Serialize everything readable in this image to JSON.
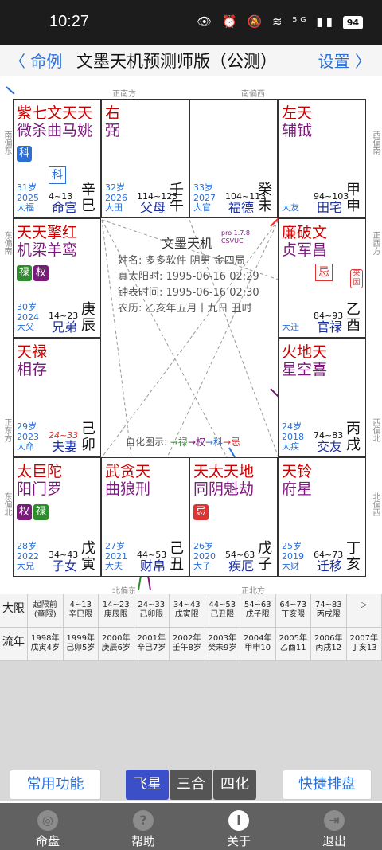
{
  "status": {
    "time": "10:27",
    "battery": "94",
    "icons": "👁 ⏰ 🔕 ≋ ⁵ᴳ ▮▮"
  },
  "nav": {
    "back": "〈 命例",
    "title": "文墨天机预测师版（公测）",
    "settings": "设置 〉"
  },
  "directions": {
    "top1": "正南方",
    "top2": "南偏西",
    "bottom1": "北偏东",
    "bottom2": "正北方",
    "left1": "南偏东",
    "left2": "东偏南",
    "left3": "正东方",
    "left4": "东偏北",
    "right1": "西偏南",
    "right2": "正西方",
    "right3": "西偏北",
    "right4": "北偏西"
  },
  "palaces": [
    {
      "stars_r": "紫七文天天",
      "stars_p": "微杀曲马姚",
      "badges": [
        {
          "t": "科",
          "c": "#2b6fd6"
        }
      ],
      "mark": "科",
      "age": "31岁",
      "year": "2025",
      "yname": "大福",
      "range": "4~13",
      "name": "命宫",
      "gz": "辛巳"
    },
    {
      "stars_r": "右",
      "stars_p": "弼",
      "badges": [],
      "mark": "",
      "age": "32岁",
      "year": "2026",
      "yname": "大田",
      "range": "114~123",
      "name": "父母",
      "gz": "壬午"
    },
    {
      "stars_r": "",
      "stars_p": "",
      "badges": [],
      "mark": "",
      "age": "33岁",
      "year": "2027",
      "yname": "大官",
      "range": "104~113",
      "name": "福德",
      "gz": "癸未"
    },
    {
      "stars_r": "左天",
      "stars_p": "辅钺",
      "badges": [],
      "mark": "",
      "age": "",
      "year": "",
      "yname": "大友",
      "range": "94~103",
      "name": "田宅",
      "gz": "甲申"
    },
    {
      "stars_r": "天天擎红",
      "stars_p": "机梁羊鸾",
      "badges": [
        {
          "t": "禄",
          "c": "#2e8b2e"
        },
        {
          "t": "权",
          "c": "#7a1a7a"
        }
      ],
      "mark": "",
      "age": "30岁",
      "year": "2024",
      "yname": "大父",
      "range": "14~23",
      "name": "兄弟",
      "gz": "庚辰"
    },
    {
      "stars_r": "廉破文",
      "stars_p": "贞军昌",
      "badges": [],
      "mark": "忌",
      "age": "",
      "year": "",
      "yname": "大迁",
      "range": "84~93",
      "name": "官禄",
      "gz": "乙酉"
    },
    {
      "stars_r": "天禄",
      "stars_p": "相存",
      "badges": [],
      "mark": "",
      "age": "29岁",
      "year": "2023",
      "yname": "大命",
      "range": "24~33",
      "name": "夫妻",
      "gz": "己卯"
    },
    {
      "stars_r": "火地天",
      "stars_p": "星空喜",
      "badges": [],
      "mark": "",
      "age": "24岁",
      "year": "2018",
      "yname": "大疾",
      "range": "74~83",
      "name": "交友",
      "gz": "丙戌"
    },
    {
      "stars_r": "太巨陀",
      "stars_p": "阳门罗",
      "badges": [
        {
          "t": "权",
          "c": "#7a1a7a"
        },
        {
          "t": "禄",
          "c": "#2e8b2e"
        }
      ],
      "mark": "",
      "age": "28岁",
      "year": "2022",
      "yname": "大兄",
      "range": "34~43",
      "name": "子女",
      "gz": "戊寅"
    },
    {
      "stars_r": "武贪天",
      "stars_p": "曲狼刑",
      "badges": [],
      "mark": "",
      "age": "27岁",
      "year": "2021",
      "yname": "大夫",
      "range": "44~53",
      "name": "财帛",
      "gz": "己丑"
    },
    {
      "stars_r": "天太天地",
      "stars_p": "同阴魁劫",
      "badges": [
        {
          "t": "忌",
          "c": "#d33"
        }
      ],
      "mark": "",
      "age": "26岁",
      "year": "2020",
      "yname": "大子",
      "range": "54~63",
      "name": "疾厄",
      "gz": "戊子"
    },
    {
      "stars_r": "天铃",
      "stars_p": "府星",
      "badges": [],
      "mark": "",
      "age": "25岁",
      "year": "2019",
      "yname": "大财",
      "range": "64~73",
      "name": "迁移",
      "gz": "丁亥"
    }
  ],
  "center": {
    "logo": "文墨天机",
    "ver": "pro 1.7.8",
    "csvuc": "CSVUC",
    "name": "姓名: 多多软件    阴男 金四局",
    "solar": "真太阳时: 1995-06-16 02:29",
    "clock": "钟表时间: 1995-06-16 02:30",
    "lunar": "农历: 乙亥年五月十九日 丑时",
    "self_prefix": "自化图示:",
    "self_marks": [
      "→禄",
      "→权",
      "→科",
      "→忌"
    ],
    "laiyin": "来因"
  },
  "daxian": {
    "label": "大限",
    "items": [
      "起限前\n(童限)",
      "4~13\n辛巳限",
      "14~23\n庚辰限",
      "24~33\n己卯限",
      "34~43\n戊寅限",
      "44~53\n己丑限",
      "54~63\n戊子限",
      "64~73\n丁亥限",
      "74~83\n丙戌限",
      "▷"
    ]
  },
  "liunian": {
    "label": "流年",
    "items": [
      "1998年\n戊寅4岁",
      "1999年\n己卯5岁",
      "2000年\n庚辰6岁",
      "2001年\n辛巳7岁",
      "2002年\n壬午8岁",
      "2003年\n癸未9岁",
      "2004年\n甲申10",
      "2005年\n乙酉11",
      "2006年\n丙戌12",
      "2007年\n丁亥13"
    ]
  },
  "buttons": {
    "common": "常用功能",
    "fly": "飞星",
    "sanhe": "三合",
    "sihua": "四化",
    "quick": "快捷排盘"
  },
  "tabs": [
    "命盘",
    "帮助",
    "关于",
    "退出"
  ]
}
